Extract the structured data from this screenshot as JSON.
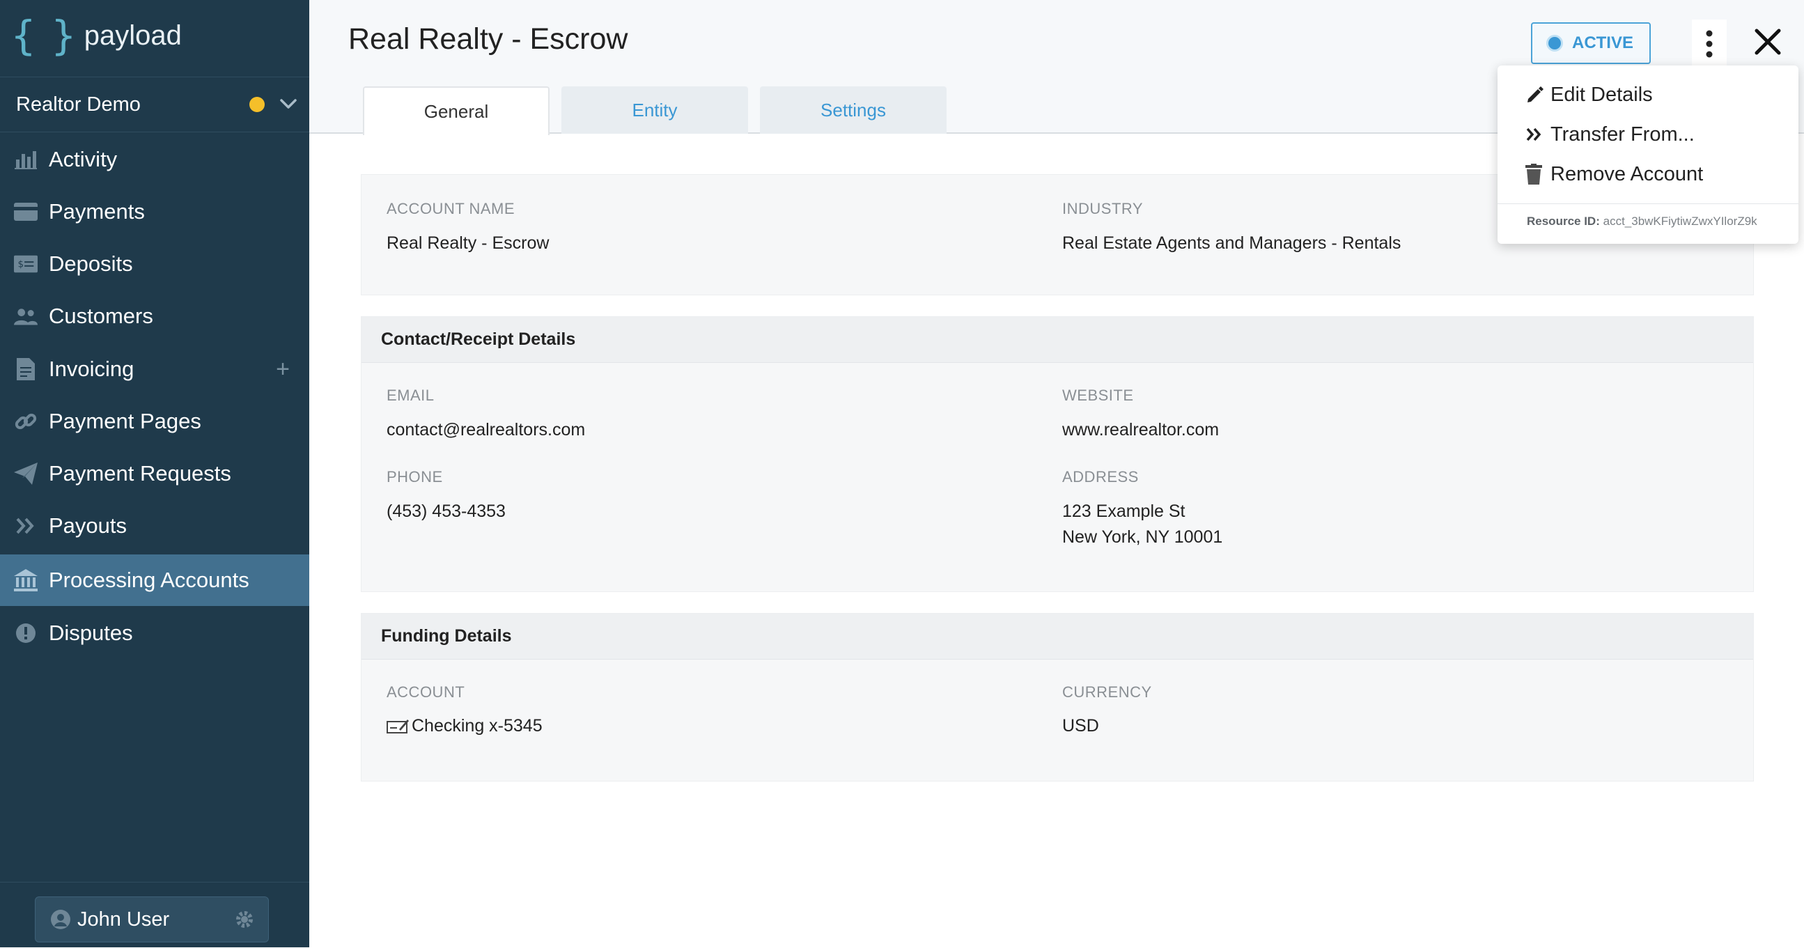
{
  "brand": {
    "name": "payload",
    "brace": "{ }"
  },
  "org": {
    "name": "Realtor Demo",
    "status_color": "#f5bf2a"
  },
  "nav": [
    {
      "label": "Activity",
      "icon": "bar-chart-icon"
    },
    {
      "label": "Payments",
      "icon": "credit-card-icon"
    },
    {
      "label": "Deposits",
      "icon": "cash-icon"
    },
    {
      "label": "Customers",
      "icon": "users-icon"
    },
    {
      "label": "Invoicing",
      "icon": "document-icon",
      "add": "+"
    },
    {
      "label": "Payment Pages",
      "icon": "link-icon"
    },
    {
      "label": "Payment Requests",
      "icon": "paper-plane-icon"
    },
    {
      "label": "Payouts",
      "icon": "double-chevron-icon"
    },
    {
      "label": "Processing Accounts",
      "icon": "bank-icon",
      "active": true
    },
    {
      "label": "Disputes",
      "icon": "alert-icon"
    }
  ],
  "user": {
    "name": "John User"
  },
  "header": {
    "title": "Real Realty - Escrow",
    "status": "ACTIVE",
    "accent": "#3a97d4"
  },
  "tabs": [
    {
      "label": "General",
      "active": true
    },
    {
      "label": "Entity",
      "active": false
    },
    {
      "label": "Settings",
      "active": false
    }
  ],
  "general": {
    "account_name_label": "ACCOUNT NAME",
    "account_name": "Real Realty - Escrow",
    "industry_label": "INDUSTRY",
    "industry": "Real Estate Agents and Managers - Rentals"
  },
  "contact": {
    "title": "Contact/Receipt Details",
    "email_label": "EMAIL",
    "email": "contact@realrealtors.com",
    "website_label": "WEBSITE",
    "website": "www.realrealtor.com",
    "phone_label": "PHONE",
    "phone": "(453) 453-4353",
    "address_label": "ADDRESS",
    "address_line1": "123 Example St",
    "address_line2": "New York, NY 10001"
  },
  "funding": {
    "title": "Funding Details",
    "account_label": "ACCOUNT",
    "account": "Checking x-5345",
    "currency_label": "CURRENCY",
    "currency": "USD"
  },
  "menu": {
    "items": [
      {
        "label": "Edit Details",
        "icon": "pencil-icon"
      },
      {
        "label": "Transfer From...",
        "icon": "double-chevron-right-icon"
      },
      {
        "label": "Remove Account",
        "icon": "trash-icon"
      }
    ],
    "resource_label": "Resource ID:",
    "resource_id": "acct_3bwKFiytiwZwxYIlorZ9k"
  }
}
